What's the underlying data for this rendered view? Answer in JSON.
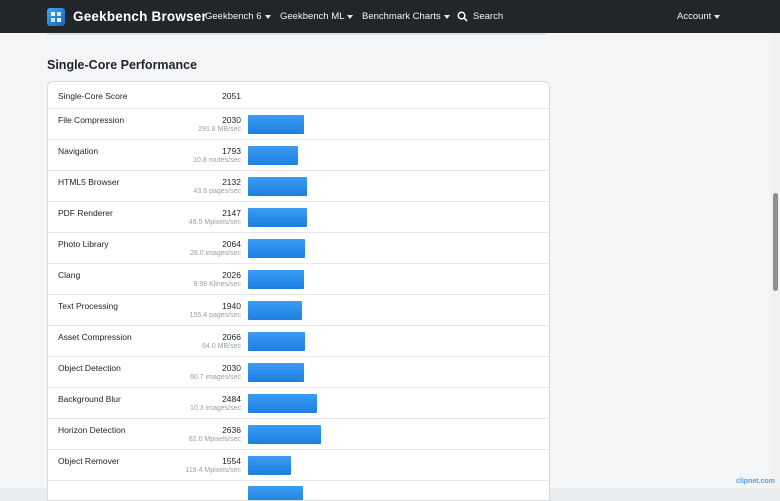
{
  "nav": {
    "brand": "Geekbench Browser",
    "geekbench6": "Geekbench 6",
    "geekbench_ml": "Geekbench ML",
    "benchmark_charts": "Benchmark Charts",
    "search": "Search",
    "account": "Account"
  },
  "section_title": "Single-Core Performance",
  "summary": {
    "label": "Single-Core Score",
    "score": "2051"
  },
  "rows": [
    {
      "name": "File Compression",
      "score": "2030",
      "sub": "291.8 MB/sec",
      "value": 2030
    },
    {
      "name": "Navigation",
      "score": "1793",
      "sub": "10.8 routes/sec",
      "value": 1793
    },
    {
      "name": "HTML5 Browser",
      "score": "2132",
      "sub": "43.6 pages/sec",
      "value": 2132
    },
    {
      "name": "PDF Renderer",
      "score": "2147",
      "sub": "49.5 Mpixels/sec",
      "value": 2147
    },
    {
      "name": "Photo Library",
      "score": "2064",
      "sub": "28.0 images/sec",
      "value": 2064
    },
    {
      "name": "Clang",
      "score": "2026",
      "sub": "9.98 Klines/sec",
      "value": 2026
    },
    {
      "name": "Text Processing",
      "score": "1940",
      "sub": "155.4 pages/sec",
      "value": 1940
    },
    {
      "name": "Asset Compression",
      "score": "2066",
      "sub": "64.0 MB/sec",
      "value": 2066
    },
    {
      "name": "Object Detection",
      "score": "2030",
      "sub": "60.7 images/sec",
      "value": 2030
    },
    {
      "name": "Background Blur",
      "score": "2484",
      "sub": "10.3 images/sec",
      "value": 2484
    },
    {
      "name": "Horizon Detection",
      "score": "2636",
      "sub": "82.0 Mpixels/sec",
      "value": 2636
    },
    {
      "name": "Object Remover",
      "score": "1554",
      "sub": "119.4 Mpixels/sec",
      "value": 1554
    }
  ],
  "colors": {
    "navbar": "#222629",
    "bar": "#1d7fe0",
    "accent": "#42a5f5"
  },
  "watermark": "clipnet.com"
}
